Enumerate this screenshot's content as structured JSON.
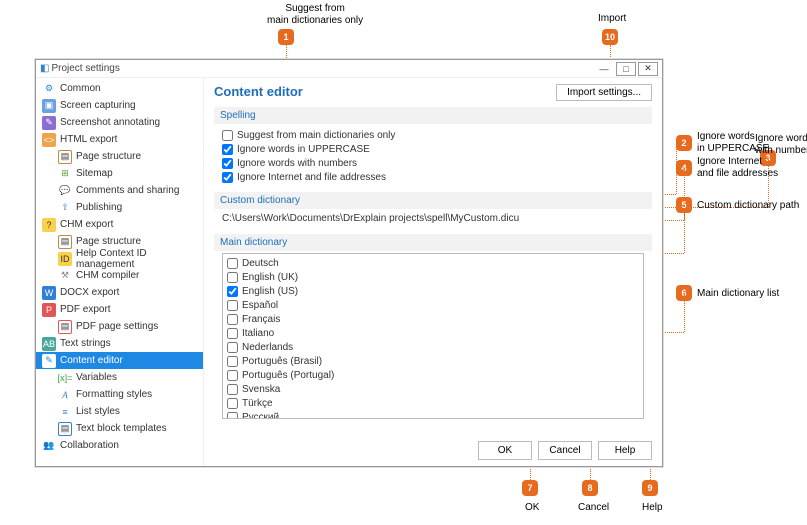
{
  "annotations": {
    "a1_label": "Suggest from\nmain dictionaries only",
    "a2_label": "Ignore words\nin UPPERCASE",
    "a3_label": "Ignore words\nwith numbers",
    "a4_label": "Ignore Internet\nand file addresses",
    "a5_label": "Custom dictionary path",
    "a6_label": "Main dictionary list",
    "a7_label": "OK",
    "a8_label": "Cancel",
    "a9_label": "Help",
    "a10_label": "Import",
    "b1": "1",
    "b2": "2",
    "b3": "3",
    "b4": "4",
    "b5": "5",
    "b6": "6",
    "b7": "7",
    "b8": "8",
    "b9": "9",
    "b10": "10"
  },
  "window": {
    "title": "Project settings",
    "minimize": "—",
    "maximize": "□",
    "close": "✕"
  },
  "sidebar": {
    "common": "Common",
    "screen_capturing": "Screen capturing",
    "screenshot_annotating": "Screenshot annotating",
    "html_export": "HTML export",
    "page_structure": "Page structure",
    "sitemap": "Sitemap",
    "comments_sharing": "Comments and sharing",
    "publishing": "Publishing",
    "chm_export": "CHM export",
    "help_context_id": "Help Context ID management",
    "chm_compiler": "CHM compiler",
    "docx_export": "DOCX export",
    "pdf_export": "PDF export",
    "pdf_page_settings": "PDF page settings",
    "text_strings": "Text strings",
    "content_editor": "Content editor",
    "variables": "Variables",
    "formatting_styles": "Formatting styles",
    "list_styles": "List styles",
    "text_block_templates": "Text block templates",
    "collaboration": "Collaboration"
  },
  "content": {
    "title": "Content editor",
    "import_btn": "Import settings...",
    "section_spelling": "Spelling",
    "chk1": "Suggest from main dictionaries only",
    "chk2": "Ignore words in UPPERCASE",
    "chk3": "Ignore words with numbers",
    "chk4": "Ignore Internet and file addresses",
    "section_custom": "Custom dictionary",
    "custom_path": "C:\\Users\\Work\\Documents\\DrExplain projects\\spell\\MyCustom.dicu",
    "section_main": "Main dictionary",
    "dicts": {
      "de": "Deutsch",
      "en_uk": "English (UK)",
      "en_us": "English (US)",
      "es": "Español",
      "fr": "Français",
      "it": "Italiano",
      "nl": "Nederlands",
      "pt_br": "Português (Brasil)",
      "pt_pt": "Português (Portugal)",
      "sv": "Svenska",
      "tr": "Türkçe",
      "ru": "Русский"
    }
  },
  "footer": {
    "ok": "OK",
    "cancel": "Cancel",
    "help": "Help"
  }
}
